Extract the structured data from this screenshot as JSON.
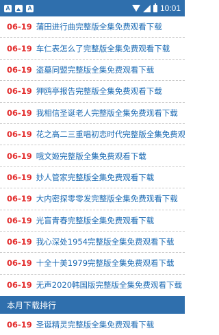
{
  "status_bar": {
    "time": "10:01",
    "left_icons": [
      "app-a-icon",
      "photo-icon",
      "app-a-icon"
    ],
    "right_icons": [
      "wifi-icon",
      "signal-icon",
      "battery-icon"
    ]
  },
  "list": [
    {
      "date": "06-19",
      "title": "蒲田进行曲完整版全集免费观看下载"
    },
    {
      "date": "06-19",
      "title": "车仁表怎么了完整版全集免费观看下载"
    },
    {
      "date": "06-19",
      "title": "盗墓同盟完整版全集免费观看下载"
    },
    {
      "date": "06-19",
      "title": "狎鸥亭报告完整版全集免费观看下载"
    },
    {
      "date": "06-19",
      "title": "我相信圣诞老人完整版全集免费观看下载"
    },
    {
      "date": "06-19",
      "title": "花之高二三重唱初恋时代完整版全集免费观看下载"
    },
    {
      "date": "06-19",
      "title": "哦文姬完整版全集免费观看下载"
    },
    {
      "date": "06-19",
      "title": "妙人管家完整版全集免费观看下载"
    },
    {
      "date": "06-19",
      "title": "大内密探零零发完整版全集免费观看下载"
    },
    {
      "date": "06-19",
      "title": "光盲青春完整版全集免费观看下载"
    },
    {
      "date": "06-19",
      "title": "我心深处1954完整版全集免费观看下载"
    },
    {
      "date": "06-19",
      "title": "十全十美1979完整版全集免费观看下载"
    },
    {
      "date": "06-19",
      "title": "无声2020韩国版完整版全集免费观看下载"
    }
  ],
  "section": {
    "title": "本月下载排行"
  },
  "ranking": [
    {
      "date": "06-19",
      "title": "圣诞精灵完整版全集免费观看下载"
    }
  ]
}
